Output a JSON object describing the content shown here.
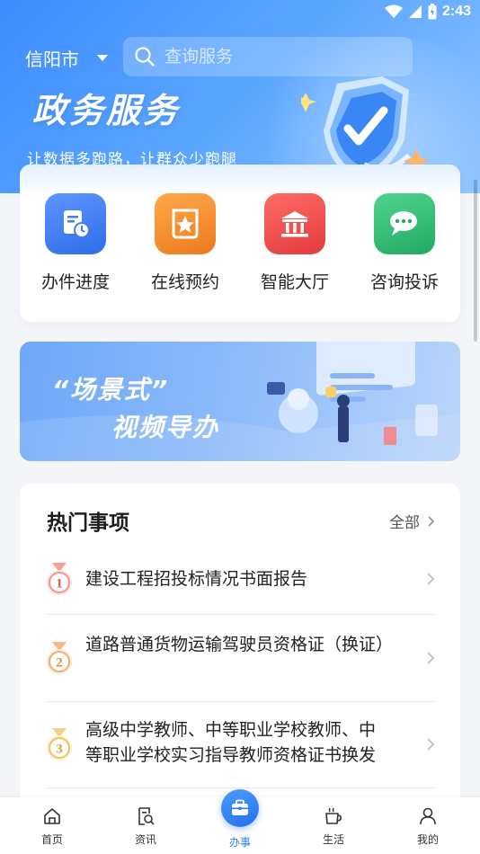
{
  "status_bar": {
    "time": "2:43"
  },
  "header": {
    "city": "信阳市",
    "search_placeholder": "查询服务",
    "title": "政务服务",
    "subtitle": "让数据多跑路，让群众少跑腿"
  },
  "quick_actions": [
    {
      "label": "办件进度",
      "icon": "progress-document-icon",
      "color": "#3f7ef2"
    },
    {
      "label": "在线预约",
      "icon": "star-appointment-icon",
      "color": "#f08a2a"
    },
    {
      "label": "智能大厅",
      "icon": "government-hall-icon",
      "color": "#ef4c48"
    },
    {
      "label": "咨询投诉",
      "icon": "chat-bubbles-icon",
      "color": "#2dbb73"
    }
  ],
  "banner": {
    "line1": "“场景式”",
    "line2": "视频导办"
  },
  "hot_items": {
    "title": "热门事项",
    "all_label": "全部",
    "items": [
      {
        "rank": "1",
        "text": "建设工程招投标情况书面报告"
      },
      {
        "rank": "2",
        "text": "道路普通货物运输驾驶员资格证（换证）"
      },
      {
        "rank": "3",
        "text": "高级中学教师、中等职业学校教师、中等职业学校实习指导教师资格证书换发"
      }
    ]
  },
  "tabbar": {
    "tabs": [
      {
        "label": "首页",
        "icon": "home-icon"
      },
      {
        "label": "资讯",
        "icon": "news-search-icon"
      },
      {
        "label": "办事",
        "icon": "briefcase-icon"
      },
      {
        "label": "生活",
        "icon": "coffee-cup-icon"
      },
      {
        "label": "我的",
        "icon": "person-icon"
      }
    ],
    "active": "办事"
  },
  "colors": {
    "primary": "#2d7cf6",
    "hero_start": "#3d8bff",
    "hero_end": "#8fc3ff"
  }
}
